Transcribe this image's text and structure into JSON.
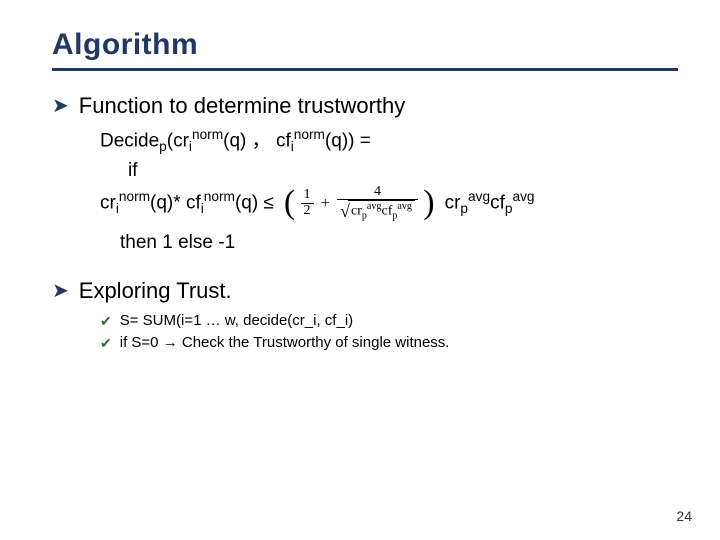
{
  "slide": {
    "title": "Algorithm",
    "page_number": "24"
  },
  "b1": {
    "heading": "Function to determine trustworthy",
    "decide_lhs": "Decide",
    "decide_sub": "p",
    "cr": "cr",
    "cf": "cf",
    "i": "i",
    "norm": "norm",
    "q": "(q)",
    "q2": "(q))",
    "comma": "，",
    "eq": " =",
    "if": "if",
    "star": "*",
    "le": " ≤ ",
    "p": "p",
    "avg": "avg",
    "then": "then 1 else -1"
  },
  "formula": {
    "half_num": "1",
    "half_den": "2",
    "four_num": "4",
    "cr": "cr",
    "cf": "cf",
    "p": "p",
    "avg": "avg"
  },
  "b2": {
    "heading": "Exploring Trust.",
    "line1": "S= SUM(i=1 … w, decide(cr_i, cf_i)",
    "line2a": "if S=0 ",
    "arrow": "→",
    "line2b": " Check the Trustworthy of single witness."
  }
}
